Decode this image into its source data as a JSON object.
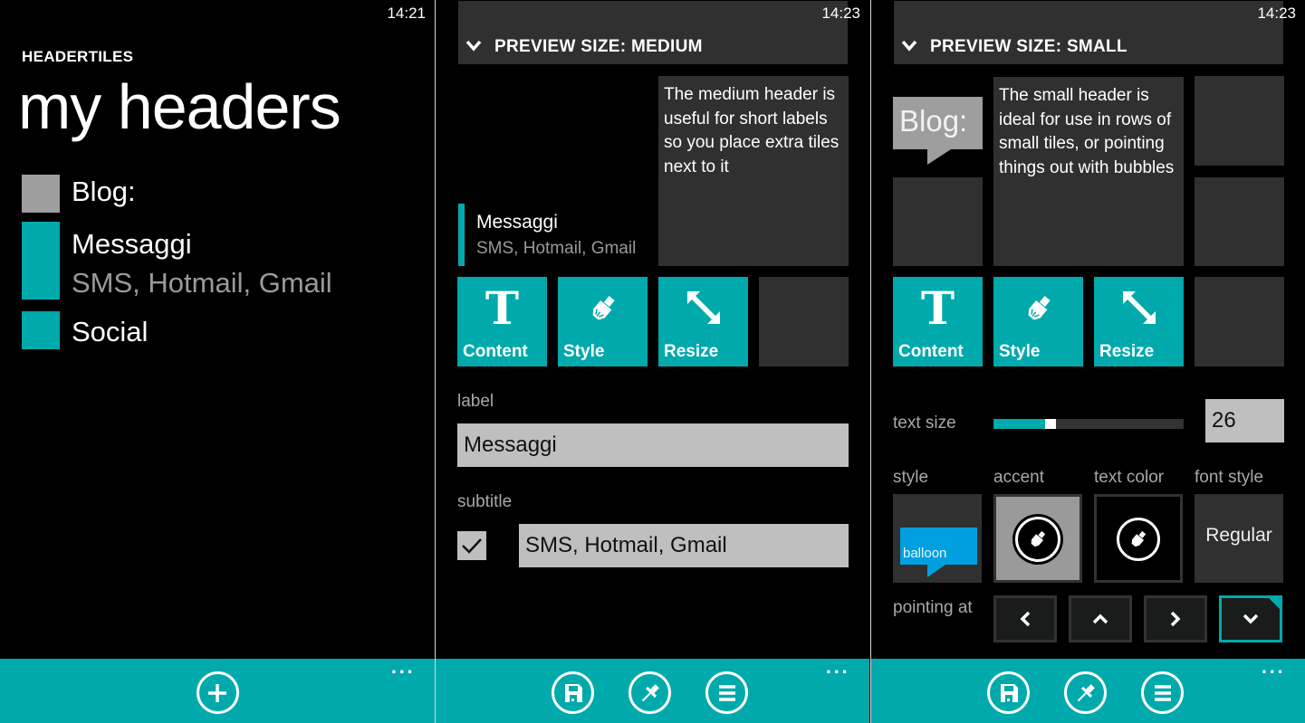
{
  "colors": {
    "accent": "#00a9ac",
    "tile_dark": "#303030",
    "blog_gray": "#9e9e9e",
    "balloon_blue": "#00a0e0",
    "input_bg": "#bfbfbf"
  },
  "panels": [
    {
      "clock": "14:21",
      "app_title": "HEADERTILES",
      "page_title": "my headers",
      "headers": [
        {
          "label": "Blog:",
          "subtitle": "",
          "swatch": "#9e9e9e"
        },
        {
          "label": "Messaggi",
          "subtitle": "SMS, Hotmail, Gmail",
          "swatch": "#00a9ac"
        },
        {
          "label": "Social",
          "subtitle": "",
          "swatch": "#00a9ac"
        }
      ],
      "appbar": {
        "buttons": [
          {
            "icon": "add-icon",
            "label": "add"
          }
        ],
        "more": "..."
      }
    },
    {
      "clock": "14:23",
      "preview_header": "PREVIEW SIZE: MEDIUM",
      "preview": {
        "label": "Messaggi",
        "subtitle": "SMS, Hotmail, Gmail",
        "description": "The medium header is useful for short labels so you place extra tiles next to it"
      },
      "actions": [
        {
          "label": "Content",
          "icon": "text-icon"
        },
        {
          "label": "Style",
          "icon": "brush-icon"
        },
        {
          "label": "Resize",
          "icon": "resize-icon"
        }
      ],
      "form": {
        "label_caption": "label",
        "label_value": "Messaggi",
        "subtitle_caption": "subtitle",
        "subtitle_checked": true,
        "subtitle_value": "SMS, Hotmail, Gmail"
      },
      "appbar": {
        "buttons": [
          {
            "icon": "save-icon"
          },
          {
            "icon": "pin-icon"
          },
          {
            "icon": "list-icon"
          }
        ],
        "more": "..."
      }
    },
    {
      "clock": "14:23",
      "preview_header": "PREVIEW SIZE: SMALL",
      "preview": {
        "label": "Blog:",
        "description": "The small header is ideal for use in rows of small tiles, or pointing things out with bubbles"
      },
      "actions": [
        {
          "label": "Content",
          "icon": "text-icon"
        },
        {
          "label": "Style",
          "icon": "brush-icon"
        },
        {
          "label": "Resize",
          "icon": "resize-icon"
        }
      ],
      "text_size": {
        "caption": "text size",
        "value": "26",
        "slider_fraction": 0.27
      },
      "options": {
        "style_caption": "style",
        "style_value": "balloon",
        "accent_caption": "accent",
        "text_color_caption": "text color",
        "font_style_caption": "font style",
        "font_style_value": "Regular"
      },
      "pointing": {
        "caption": "pointing at",
        "directions": [
          "left",
          "up",
          "right",
          "down"
        ],
        "selected": "down"
      },
      "appbar": {
        "buttons": [
          {
            "icon": "save-icon"
          },
          {
            "icon": "pin-icon"
          },
          {
            "icon": "list-icon"
          }
        ],
        "more": "..."
      }
    }
  ]
}
